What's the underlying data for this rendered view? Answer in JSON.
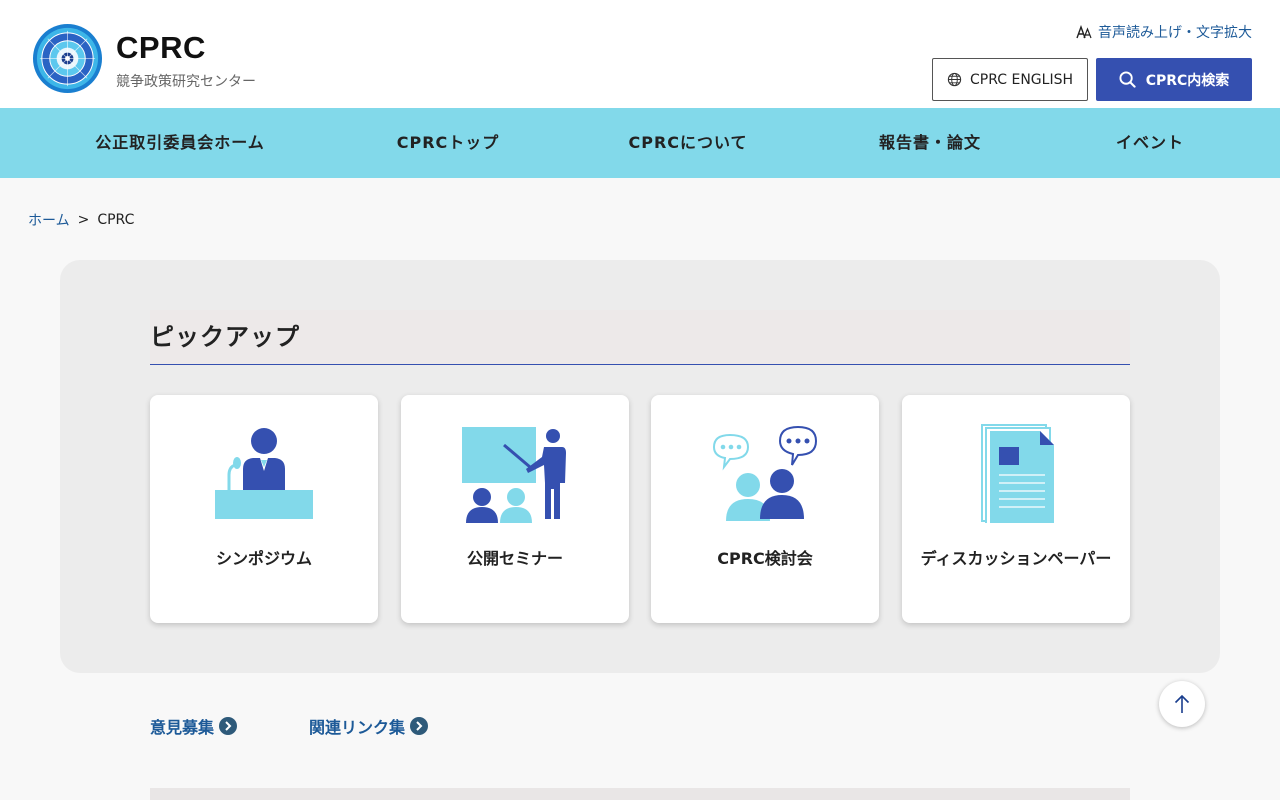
{
  "header": {
    "site_title": "CPRC",
    "site_subtitle": "競争政策研究センター",
    "a11y_label": "音声読み上げ・文字拡大",
    "english_label": "CPRC ENGLISH",
    "search_label": "CPRC内検索"
  },
  "nav": {
    "items": [
      {
        "label": "公正取引委員会ホーム"
      },
      {
        "label": "CPRCトップ"
      },
      {
        "label": "CPRCについて"
      },
      {
        "label": "報告書・論文"
      },
      {
        "label": "イベント"
      }
    ]
  },
  "breadcrumb": {
    "home": "ホーム",
    "separator": ">",
    "current": "CPRC"
  },
  "pickup": {
    "title": "ピックアップ",
    "cards": [
      {
        "label": "シンポジウム",
        "icon": "podium-speaker-icon"
      },
      {
        "label": "公開セミナー",
        "icon": "seminar-presenter-icon"
      },
      {
        "label": "CPRC検討会",
        "icon": "discussion-icon"
      },
      {
        "label": "ディスカッションペーパー",
        "icon": "document-paper-icon"
      }
    ]
  },
  "links": {
    "opinion": "意見募集",
    "related": "関連リンク集"
  },
  "colors": {
    "accent": "#3550b0",
    "nav_bg": "#82d9ea",
    "link": "#1d5a98",
    "illustration_dark": "#3550b0",
    "illustration_light": "#82d9ea"
  }
}
